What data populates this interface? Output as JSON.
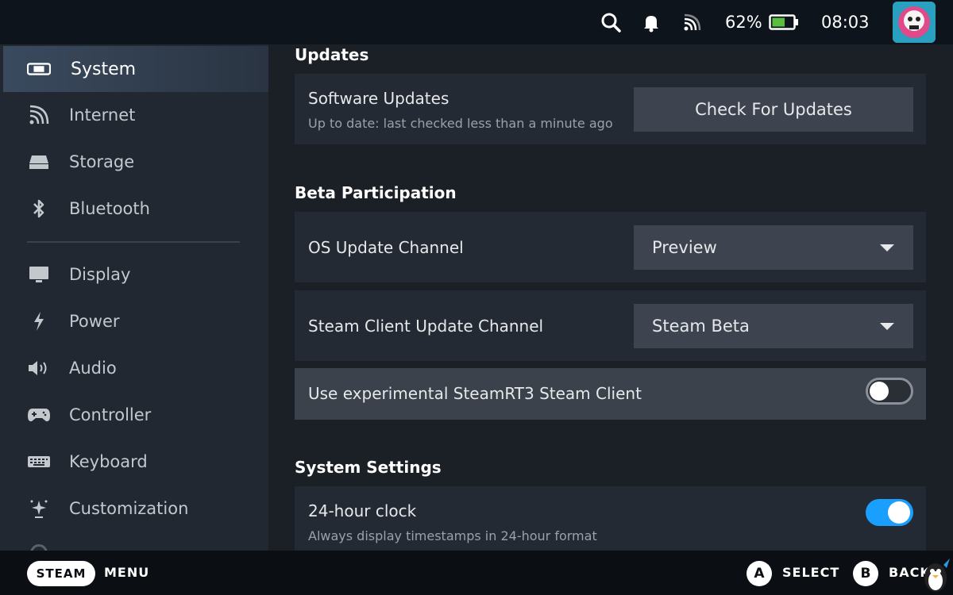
{
  "status_bar": {
    "battery_percent": "62%",
    "battery_level": 0.62,
    "time": "08:03",
    "icons": [
      "search-icon",
      "bell-icon",
      "wifi-icon",
      "battery-icon"
    ]
  },
  "sidebar": {
    "items": [
      {
        "label": "System",
        "icon": "system-icon",
        "active": true
      },
      {
        "label": "Internet",
        "icon": "wifi-icon"
      },
      {
        "label": "Storage",
        "icon": "storage-icon"
      },
      {
        "label": "Bluetooth",
        "icon": "bluetooth-icon"
      },
      {
        "label": "Display",
        "icon": "monitor-icon"
      },
      {
        "label": "Power",
        "icon": "lightning-icon"
      },
      {
        "label": "Audio",
        "icon": "speaker-icon"
      },
      {
        "label": "Controller",
        "icon": "gamepad-icon"
      },
      {
        "label": "Keyboard",
        "icon": "keyboard-icon"
      },
      {
        "label": "Customization",
        "icon": "sparkle-icon"
      }
    ]
  },
  "main": {
    "updates": {
      "title": "Updates",
      "software_label": "Software Updates",
      "software_status": "Up to date: last checked less than a minute ago",
      "check_button": "Check For Updates"
    },
    "beta": {
      "title": "Beta Participation",
      "os_channel_label": "OS Update Channel",
      "os_channel_value": "Preview",
      "client_channel_label": "Steam Client Update Channel",
      "client_channel_value": "Steam Beta",
      "experimental_label": "Use experimental SteamRT3 Steam Client",
      "experimental_enabled": false
    },
    "system_settings": {
      "title": "System Settings",
      "clock_label": "24-hour clock",
      "clock_desc": "Always display timestamps in 24-hour format",
      "clock_enabled": true
    }
  },
  "bottom_bar": {
    "steam": "STEAM",
    "menu": "MENU",
    "a_glyph": "A",
    "select": "SELECT",
    "b_glyph": "B",
    "back": "BACK"
  },
  "colors": {
    "accent": "#1a9fff",
    "sidebar_bg": "#222831",
    "content_bg": "#1b1f26",
    "battery_green": "#59bf40"
  }
}
